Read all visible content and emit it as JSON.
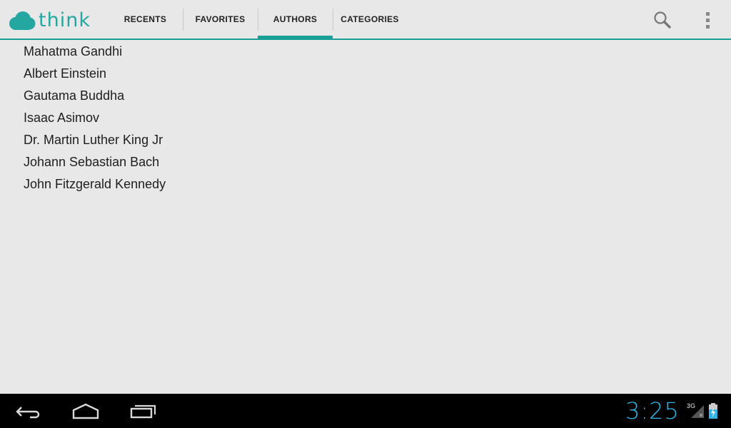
{
  "app": {
    "logo_text": "think",
    "brand_color": "#1a9f98"
  },
  "tabs": [
    {
      "label": "RECENTS",
      "active": false
    },
    {
      "label": "FAVORITES",
      "active": false
    },
    {
      "label": "AUTHORS",
      "active": true
    },
    {
      "label": "CATEGORIES",
      "active": false
    }
  ],
  "actions": {
    "search_icon": "search-icon",
    "overflow_icon": "overflow-menu-icon"
  },
  "authors": [
    "Mahatma Gandhi",
    "Albert Einstein",
    "Gautama Buddha",
    "Isaac Asimov",
    "Dr. Martin Luther King Jr",
    "Johann Sebastian Bach",
    "John Fitzgerald Kennedy"
  ],
  "system_bar": {
    "clock": "3:25",
    "network": "3G",
    "clock_color": "#33b5e5"
  }
}
